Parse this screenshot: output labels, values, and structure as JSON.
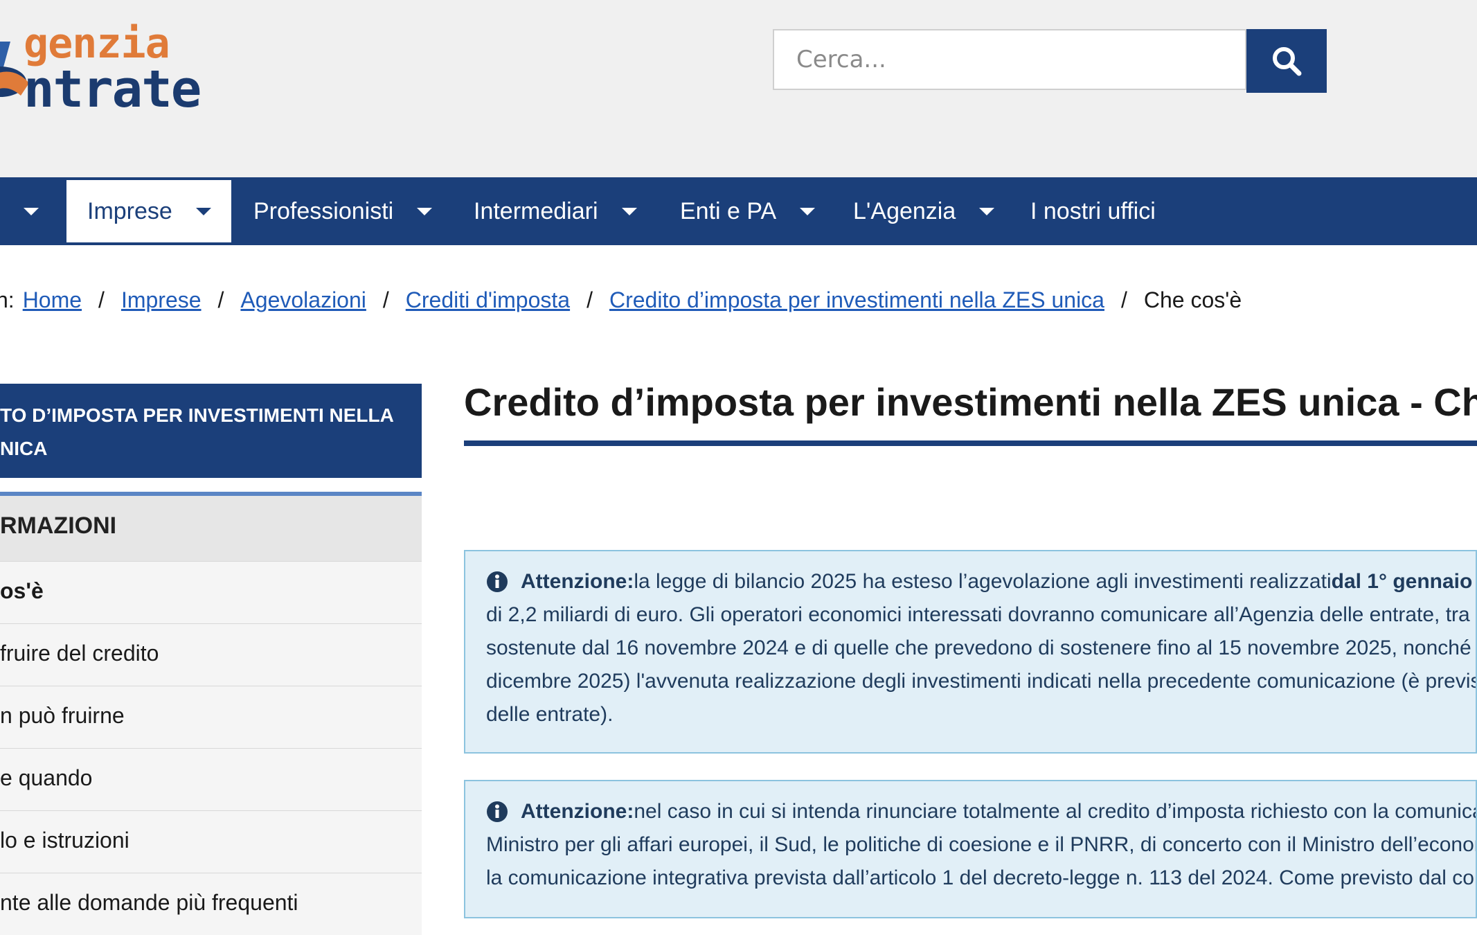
{
  "header": {
    "logo": {
      "top": "genzia",
      "bottom": "ntrate"
    },
    "search": {
      "placeholder": "Cerca..."
    }
  },
  "nav": {
    "items": [
      {
        "label": "",
        "has_caret": true
      },
      {
        "label": "Imprese",
        "has_caret": true,
        "active": true
      },
      {
        "label": "Professionisti",
        "has_caret": true
      },
      {
        "label": "Intermediari",
        "has_caret": true
      },
      {
        "label": "Enti e PA",
        "has_caret": true
      },
      {
        "label": "L'Agenzia",
        "has_caret": true
      },
      {
        "label": "I nostri uffici",
        "has_caret": false
      }
    ]
  },
  "breadcrumb": {
    "prefix": "n:",
    "items": [
      "Home",
      "Imprese",
      "Agevolazioni",
      "Crediti d'imposta",
      "Credito d’imposta per investimenti nella ZES unica"
    ],
    "current": "Che cos'è"
  },
  "sidebar": {
    "title_line1": "TO D’IMPOSTA PER INVESTIMENTI NELLA",
    "title_line2": "NICA",
    "section": "RMAZIONI",
    "items": [
      "os'è",
      "fruire del credito",
      "n può fruirne",
      "e quando",
      "lo e istruzioni",
      "nte alle domande più frequenti"
    ]
  },
  "main": {
    "title": "Credito d’imposta per investimenti nella ZES unica - Che co",
    "alerts": [
      {
        "label": "Attenzione:",
        "first_line": "la legge di bilancio 2025 ha esteso l’agevolazione agli investimenti realizzati ",
        "first_line_bold": "dal 1° gennaio",
        "lines": [
          "di 2,2 miliardi di euro. Gli operatori economici interessati dovranno comunicare all’Agenzia delle entrate, tra",
          "sostenute dal 16 novembre 2024 e di quelle che prevedono di sostenere fino al 15 novembre 2025, nonché",
          "dicembre 2025) l'avvenuta realizzazione degli investimenti indicati nella precedente comunicazione (è previs",
          "delle entrate)."
        ]
      },
      {
        "label": "Attenzione:",
        "first_line": "nel caso in cui si intenda rinunciare totalmente al credito d’imposta richiesto con la comunica",
        "first_line_bold": "",
        "lines": [
          "Ministro per gli affari europei, il Sud, le politiche di coesione e il PNRR, di concerto con il Ministro dell’econon",
          "la comunicazione integrativa prevista dall’articolo 1 del decreto-legge n. 113 del 2024. Come previsto dal co"
        ]
      }
    ]
  },
  "colors": {
    "brand_blue": "#1b3f7a",
    "logo_orange": "#e07b39",
    "link": "#1f5bb8",
    "alert_bg": "#e1eff7"
  }
}
